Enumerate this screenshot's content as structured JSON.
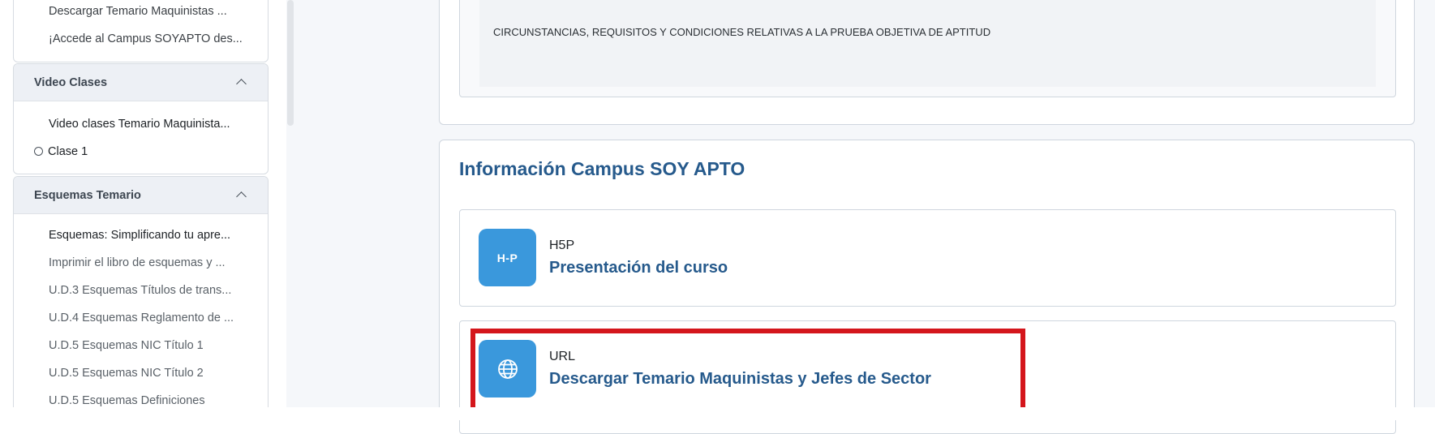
{
  "sidebar": {
    "top_items": [
      "Descargar Temario Maquinistas ...",
      "¡Accede al Campus SOYAPTO des..."
    ],
    "video_section": {
      "title": "Video Clases",
      "items": [
        "Video clases Temario Maquinista...",
        "Clase 1"
      ]
    },
    "schemas_section": {
      "title": "Esquemas Temario",
      "items": [
        "Esquemas: Simplificando tu apre...",
        "Imprimir el libro de esquemas y ...",
        "U.D.3 Esquemas Títulos de trans...",
        "U.D.4 Esquemas Reglamento de ...",
        "U.D.5 Esquemas NIC Título 1",
        "U.D.5 Esquemas NIC Título 2",
        "U.D.5 Esquemas Definiciones"
      ]
    }
  },
  "main": {
    "prev_card_text": "CIRCUNSTANCIAS, REQUISITOS Y CONDICIONES RELATIVAS A LA PRUEBA OBJETIVA DE APTITUD",
    "section_title": "Información Campus SOY APTO",
    "activities": [
      {
        "type": "H5P",
        "name": "Presentación del curso",
        "icon": "h5p-icon",
        "icon_text": "H-P"
      },
      {
        "type": "URL",
        "name": "Descargar Temario Maquinistas y Jefes de Sector",
        "icon": "globe-icon"
      }
    ]
  },
  "colors": {
    "accent": "#265a8c",
    "icon_bg": "#3a98dc",
    "highlight": "#d4161c"
  }
}
